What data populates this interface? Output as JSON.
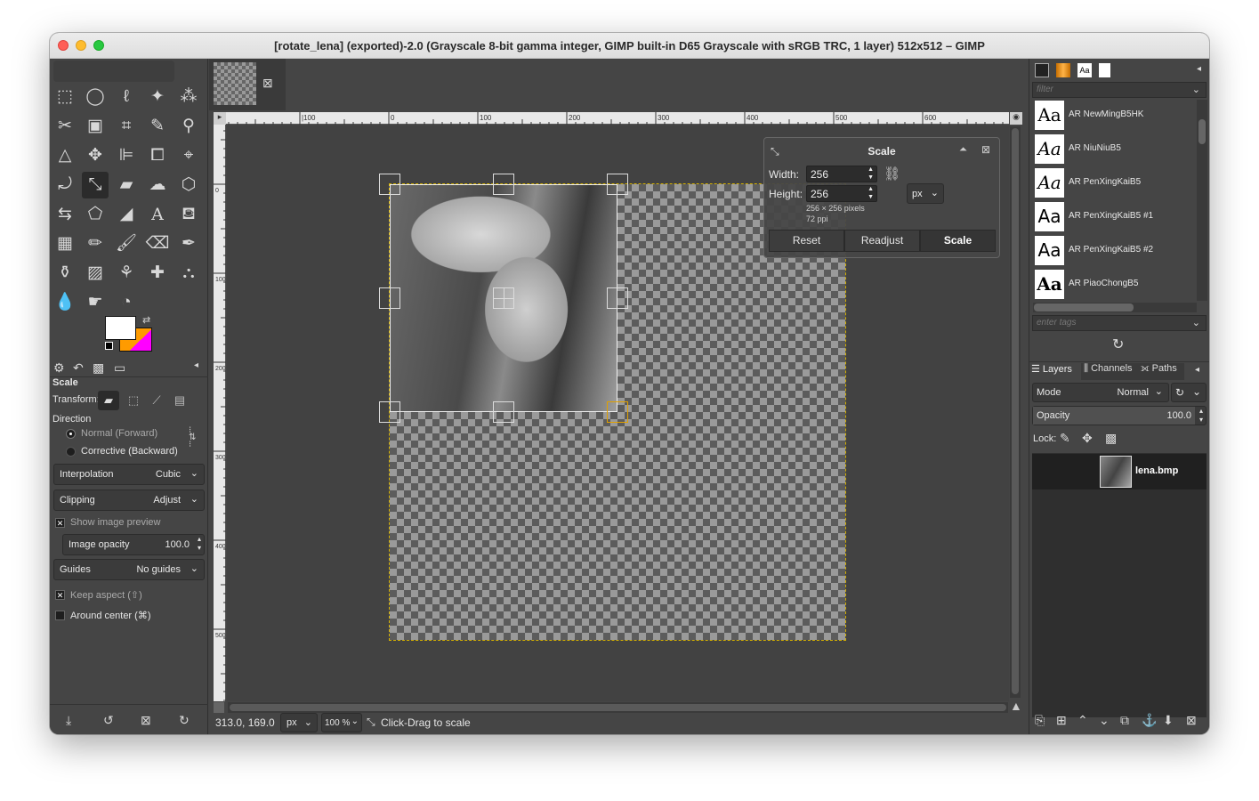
{
  "window": {
    "title": "[rotate_lena] (exported)-2.0 (Grayscale 8-bit gamma integer, GIMP built-in D65 Grayscale with sRGB TRC, 1 layer) 512x512 – GIMP"
  },
  "colors": {
    "close": "#ff5f57",
    "minimize": "#febc2e",
    "zoom": "#28c840",
    "fg_color": "#ffffff",
    "bg_color": "#ff9b00",
    "selection": "#d4b000"
  },
  "ruler": {
    "h_ticks": [
      "|100",
      "0",
      "100",
      "200",
      "300",
      "400",
      "500",
      "600"
    ],
    "v_ticks": [
      "0",
      "100",
      "200",
      "300",
      "400",
      "500"
    ]
  },
  "tool_options": {
    "title": "Scale",
    "transform_label": "Transform:",
    "direction_label": "Direction",
    "direction_normal": "Normal (Forward)",
    "direction_corrective": "Corrective (Backward)",
    "interpolation_label": "Interpolation",
    "interpolation_value": "Cubic",
    "clipping_label": "Clipping",
    "clipping_value": "Adjust",
    "show_preview": "Show image preview",
    "image_opacity_label": "Image opacity",
    "image_opacity_value": "100.0",
    "guides_label": "Guides",
    "guides_value": "No guides",
    "keep_aspect": "Keep aspect (⇧)",
    "around_center": "Around center (⌘)"
  },
  "scale_dialog": {
    "title": "Scale",
    "width_label": "Width:",
    "width_value": "256",
    "height_label": "Height:",
    "height_value": "256",
    "unit": "px",
    "info_pixels": "256 × 256 pixels",
    "info_ppi": "72 ppi",
    "reset": "Reset",
    "readjust": "Readjust",
    "scale": "Scale"
  },
  "statusbar": {
    "coords": "313.0, 169.0",
    "unit": "px",
    "zoom": "100 %",
    "message": "Click-Drag to scale"
  },
  "fonts_panel": {
    "filter_placeholder": "filter",
    "tags_placeholder": "enter tags",
    "items": [
      {
        "name": "AR NewMingB5HK",
        "preview": "Aa"
      },
      {
        "name": "AR NiuNiuB5",
        "preview": "Aa"
      },
      {
        "name": "AR PenXingKaiB5",
        "preview": "Aa"
      },
      {
        "name": "AR PenXingKaiB5 #1",
        "preview": "Aa"
      },
      {
        "name": "AR PenXingKaiB5 #2",
        "preview": "Aa"
      },
      {
        "name": "AR PiaoChongB5",
        "preview": "Aa"
      }
    ]
  },
  "layers_panel": {
    "tabs": [
      "Layers",
      "Channels",
      "Paths"
    ],
    "mode_label": "Mode",
    "mode_value": "Normal",
    "opacity_label": "Opacity",
    "opacity_value": "100.0",
    "lock_label": "Lock:",
    "layer_name": "lena.bmp"
  }
}
